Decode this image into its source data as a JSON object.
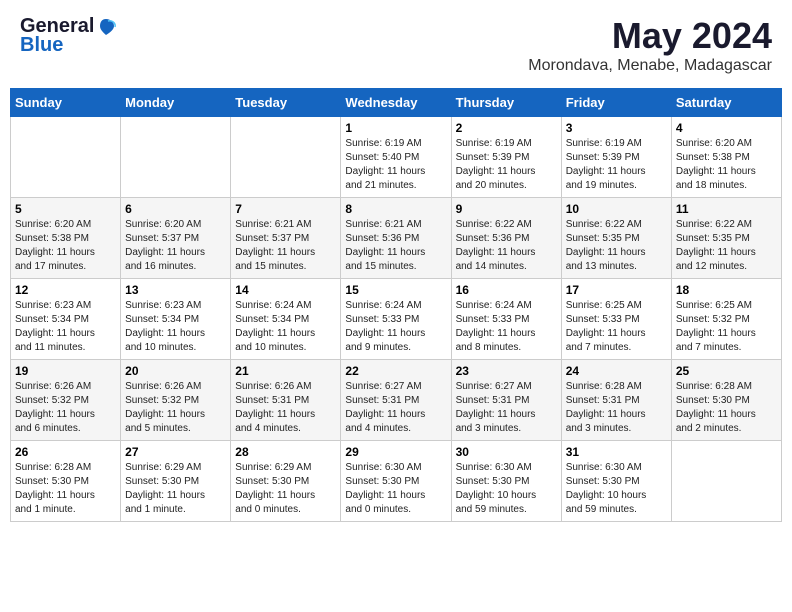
{
  "logo": {
    "general": "General",
    "blue": "Blue"
  },
  "title": {
    "month": "May 2024",
    "location": "Morondava, Menabe, Madagascar"
  },
  "headers": [
    "Sunday",
    "Monday",
    "Tuesday",
    "Wednesday",
    "Thursday",
    "Friday",
    "Saturday"
  ],
  "weeks": [
    [
      {
        "day": "",
        "info": ""
      },
      {
        "day": "",
        "info": ""
      },
      {
        "day": "",
        "info": ""
      },
      {
        "day": "1",
        "info": "Sunrise: 6:19 AM\nSunset: 5:40 PM\nDaylight: 11 hours\nand 21 minutes."
      },
      {
        "day": "2",
        "info": "Sunrise: 6:19 AM\nSunset: 5:39 PM\nDaylight: 11 hours\nand 20 minutes."
      },
      {
        "day": "3",
        "info": "Sunrise: 6:19 AM\nSunset: 5:39 PM\nDaylight: 11 hours\nand 19 minutes."
      },
      {
        "day": "4",
        "info": "Sunrise: 6:20 AM\nSunset: 5:38 PM\nDaylight: 11 hours\nand 18 minutes."
      }
    ],
    [
      {
        "day": "5",
        "info": "Sunrise: 6:20 AM\nSunset: 5:38 PM\nDaylight: 11 hours\nand 17 minutes."
      },
      {
        "day": "6",
        "info": "Sunrise: 6:20 AM\nSunset: 5:37 PM\nDaylight: 11 hours\nand 16 minutes."
      },
      {
        "day": "7",
        "info": "Sunrise: 6:21 AM\nSunset: 5:37 PM\nDaylight: 11 hours\nand 15 minutes."
      },
      {
        "day": "8",
        "info": "Sunrise: 6:21 AM\nSunset: 5:36 PM\nDaylight: 11 hours\nand 15 minutes."
      },
      {
        "day": "9",
        "info": "Sunrise: 6:22 AM\nSunset: 5:36 PM\nDaylight: 11 hours\nand 14 minutes."
      },
      {
        "day": "10",
        "info": "Sunrise: 6:22 AM\nSunset: 5:35 PM\nDaylight: 11 hours\nand 13 minutes."
      },
      {
        "day": "11",
        "info": "Sunrise: 6:22 AM\nSunset: 5:35 PM\nDaylight: 11 hours\nand 12 minutes."
      }
    ],
    [
      {
        "day": "12",
        "info": "Sunrise: 6:23 AM\nSunset: 5:34 PM\nDaylight: 11 hours\nand 11 minutes."
      },
      {
        "day": "13",
        "info": "Sunrise: 6:23 AM\nSunset: 5:34 PM\nDaylight: 11 hours\nand 10 minutes."
      },
      {
        "day": "14",
        "info": "Sunrise: 6:24 AM\nSunset: 5:34 PM\nDaylight: 11 hours\nand 10 minutes."
      },
      {
        "day": "15",
        "info": "Sunrise: 6:24 AM\nSunset: 5:33 PM\nDaylight: 11 hours\nand 9 minutes."
      },
      {
        "day": "16",
        "info": "Sunrise: 6:24 AM\nSunset: 5:33 PM\nDaylight: 11 hours\nand 8 minutes."
      },
      {
        "day": "17",
        "info": "Sunrise: 6:25 AM\nSunset: 5:33 PM\nDaylight: 11 hours\nand 7 minutes."
      },
      {
        "day": "18",
        "info": "Sunrise: 6:25 AM\nSunset: 5:32 PM\nDaylight: 11 hours\nand 7 minutes."
      }
    ],
    [
      {
        "day": "19",
        "info": "Sunrise: 6:26 AM\nSunset: 5:32 PM\nDaylight: 11 hours\nand 6 minutes."
      },
      {
        "day": "20",
        "info": "Sunrise: 6:26 AM\nSunset: 5:32 PM\nDaylight: 11 hours\nand 5 minutes."
      },
      {
        "day": "21",
        "info": "Sunrise: 6:26 AM\nSunset: 5:31 PM\nDaylight: 11 hours\nand 4 minutes."
      },
      {
        "day": "22",
        "info": "Sunrise: 6:27 AM\nSunset: 5:31 PM\nDaylight: 11 hours\nand 4 minutes."
      },
      {
        "day": "23",
        "info": "Sunrise: 6:27 AM\nSunset: 5:31 PM\nDaylight: 11 hours\nand 3 minutes."
      },
      {
        "day": "24",
        "info": "Sunrise: 6:28 AM\nSunset: 5:31 PM\nDaylight: 11 hours\nand 3 minutes."
      },
      {
        "day": "25",
        "info": "Sunrise: 6:28 AM\nSunset: 5:30 PM\nDaylight: 11 hours\nand 2 minutes."
      }
    ],
    [
      {
        "day": "26",
        "info": "Sunrise: 6:28 AM\nSunset: 5:30 PM\nDaylight: 11 hours\nand 1 minute."
      },
      {
        "day": "27",
        "info": "Sunrise: 6:29 AM\nSunset: 5:30 PM\nDaylight: 11 hours\nand 1 minute."
      },
      {
        "day": "28",
        "info": "Sunrise: 6:29 AM\nSunset: 5:30 PM\nDaylight: 11 hours\nand 0 minutes."
      },
      {
        "day": "29",
        "info": "Sunrise: 6:30 AM\nSunset: 5:30 PM\nDaylight: 11 hours\nand 0 minutes."
      },
      {
        "day": "30",
        "info": "Sunrise: 6:30 AM\nSunset: 5:30 PM\nDaylight: 10 hours\nand 59 minutes."
      },
      {
        "day": "31",
        "info": "Sunrise: 6:30 AM\nSunset: 5:30 PM\nDaylight: 10 hours\nand 59 minutes."
      },
      {
        "day": "",
        "info": ""
      }
    ]
  ]
}
